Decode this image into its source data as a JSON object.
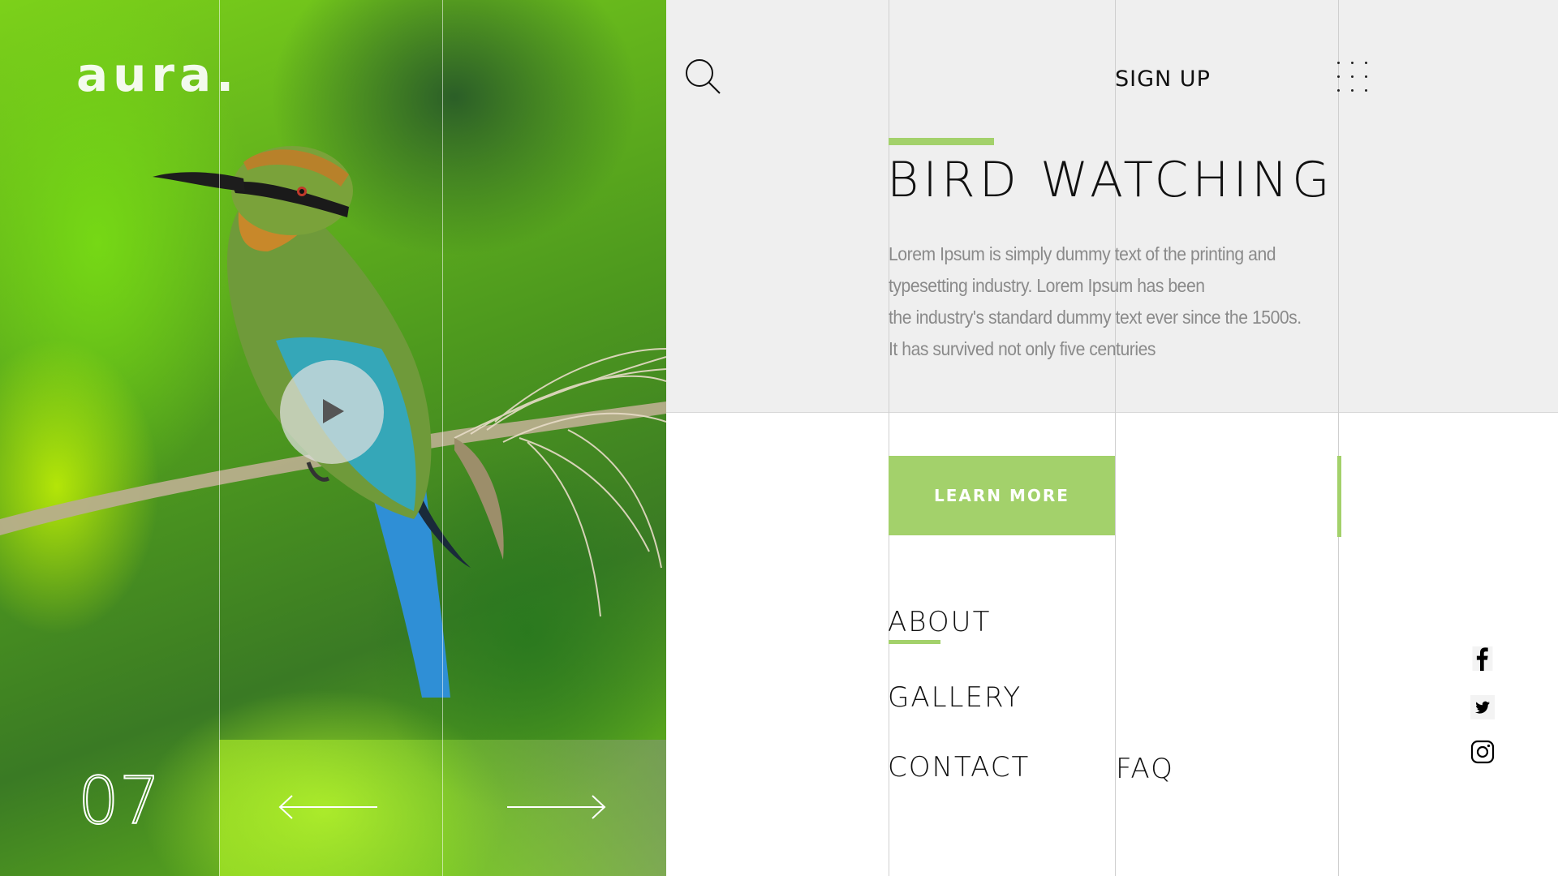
{
  "brand": {
    "logo": "aura."
  },
  "hero": {
    "slide_number": "07",
    "play_label": "play video",
    "prev_label": "previous slide",
    "next_label": "next slide"
  },
  "header": {
    "signup_label": "SIGN UP"
  },
  "main": {
    "title": "BIRD  WATCHING",
    "description": [
      "Lorem Ipsum is simply dummy text of the printing and",
      "typesetting industry. Lorem Ipsum has been",
      "the industry's standard dummy text ever since the 1500s.",
      "It has survived not only five centuries"
    ],
    "cta_label": "LEARN MORE"
  },
  "nav": {
    "about": "ABOUT",
    "gallery": "GALLERY",
    "contact": "CONTACT",
    "faq": "FAQ"
  },
  "social": [
    "facebook-icon",
    "twitter-icon",
    "instagram-icon"
  ],
  "colors": {
    "accent": "#a3d16b",
    "panel_bg": "#efefef",
    "text_dark": "#111111",
    "text_muted": "#8a8a8a"
  }
}
